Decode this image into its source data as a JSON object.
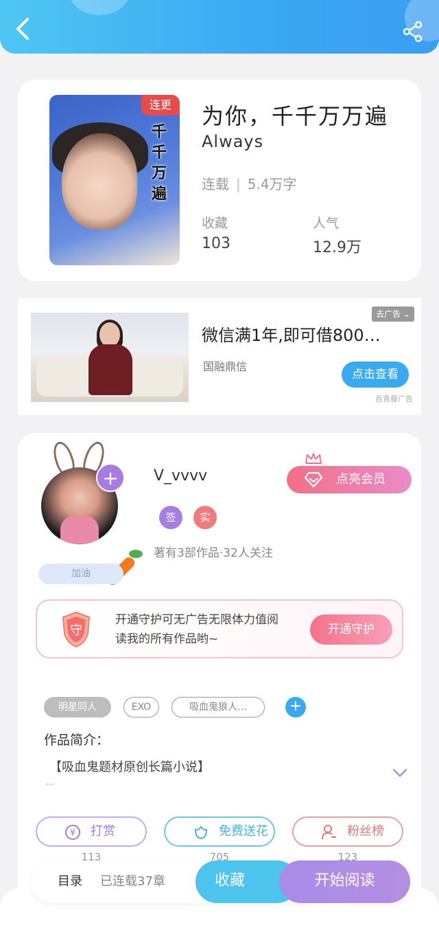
{
  "book": {
    "cover_badge": "连更",
    "cover_vertical_text": "千千万遍",
    "title": "为你，千千万万遍",
    "subtitle": "Always",
    "status": "连载",
    "word_count": "5.4万字",
    "favorites_label": "收藏",
    "favorites_value": "103",
    "popularity_label": "人气",
    "popularity_value": "12.9万"
  },
  "ad": {
    "title": "微信满1年,即可借800…",
    "source": "国融鼎信",
    "close_label": "去广告",
    "view_button": "点击查看",
    "brand": "百青藤广告"
  },
  "author": {
    "name": "V_vvvv",
    "cheer_badge": "加油",
    "tag_signed": "签",
    "tag_verified": "实",
    "stats": "著有3部作品·32人关注",
    "vip_button": "点亮会员",
    "guard_text": "开通守护可无广告无限体力值阅读我的所有作品哟~",
    "guard_shield_char": "守",
    "guard_button": "开通守护"
  },
  "tags": [
    "明星同人",
    "EXO",
    "吸血鬼狼人…"
  ],
  "intro": {
    "label": "作品简介：",
    "text": "【吸血鬼题材原创长篇小说】",
    "ellipsis": "..."
  },
  "actions": [
    {
      "label": "打赏",
      "count": "113",
      "icon": "yen-icon"
    },
    {
      "label": "免费送花",
      "count": "705",
      "icon": "flower-icon"
    },
    {
      "label": "粉丝榜",
      "count": "123",
      "icon": "user-rank-icon"
    }
  ],
  "bottom_bar": {
    "catalog": "目录",
    "chapters": "已连载37章",
    "favorite": "收藏",
    "start_reading": "开始阅读"
  },
  "colors": {
    "header_blue": "#3aa8f2",
    "accent_purple": "#a67ee0",
    "accent_pink": "#f36f86",
    "accent_cyan": "#4cc4ee"
  }
}
